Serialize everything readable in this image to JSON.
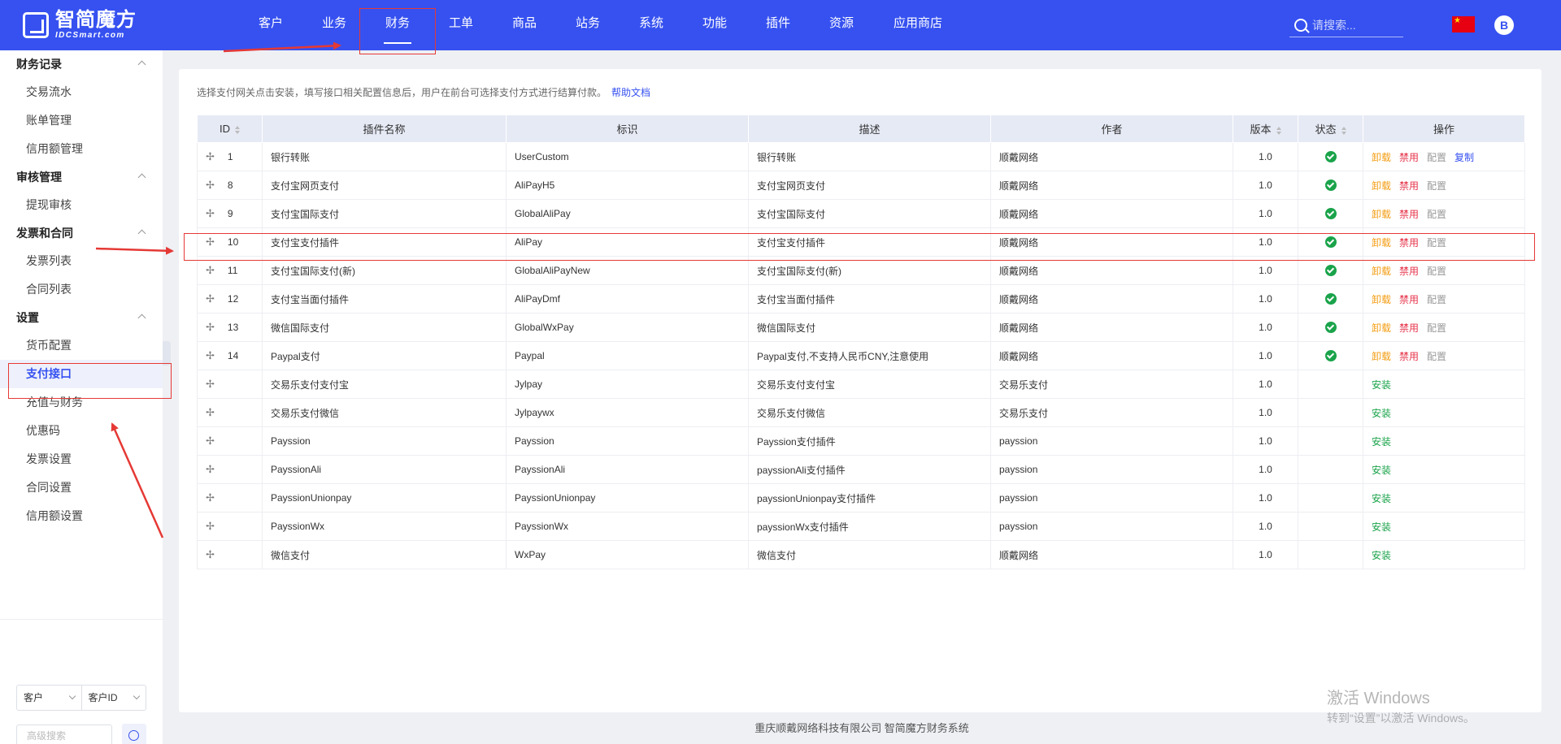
{
  "header": {
    "logo_name": "智简魔方",
    "logo_sub": "IDCSmart.com",
    "nav": [
      "客户",
      "业务",
      "财务",
      "工单",
      "商品",
      "站务",
      "系统",
      "功能",
      "插件",
      "资源",
      "应用商店"
    ],
    "active_nav": "财务",
    "search_placeholder": "请搜索...",
    "avatar_letter": "B"
  },
  "sidebar": {
    "groups": [
      {
        "title": "财务记录",
        "items": [
          "交易流水",
          "账单管理",
          "信用额管理"
        ]
      },
      {
        "title": "审核管理",
        "items": [
          "提现审核"
        ]
      },
      {
        "title": "发票和合同",
        "items": [
          "发票列表",
          "合同列表"
        ]
      },
      {
        "title": "设置",
        "items": [
          "货币配置",
          "支付接口",
          "充值与财务",
          "优惠码",
          "发票设置",
          "合同设置",
          "信用额设置"
        ]
      }
    ],
    "active_item": "支付接口",
    "bottom": {
      "select_1": "客户",
      "select_2": "客户ID",
      "adv_search_placeholder": "高级搜索"
    }
  },
  "main": {
    "intro": "选择支付网关点击安装，填写接口相关配置信息后，用户在前台可选择支付方式进行结算付款。",
    "help_link": "帮助文档",
    "columns": [
      "ID",
      "插件名称",
      "标识",
      "描述",
      "作者",
      "版本",
      "状态",
      "操作"
    ],
    "action_labels": {
      "uninstall": "卸载",
      "disable": "禁用",
      "config": "配置",
      "copy": "复制",
      "install": "安装"
    },
    "rows": [
      {
        "id": "1",
        "name": "银行转账",
        "ident": "UserCustom",
        "desc": "银行转账",
        "author": "顺戴网络",
        "version": "1.0",
        "installed": true,
        "copy": true
      },
      {
        "id": "8",
        "name": "支付宝网页支付",
        "ident": "AliPayH5",
        "desc": "支付宝网页支付",
        "author": "顺戴网络",
        "version": "1.0",
        "installed": true,
        "copy": false
      },
      {
        "id": "9",
        "name": "支付宝国际支付",
        "ident": "GlobalAliPay",
        "desc": "支付宝国际支付",
        "author": "顺戴网络",
        "version": "1.0",
        "installed": true,
        "copy": false
      },
      {
        "id": "10",
        "name": "支付宝支付插件",
        "ident": "AliPay",
        "desc": "支付宝支付插件",
        "author": "顺戴网络",
        "version": "1.0",
        "installed": true,
        "copy": false
      },
      {
        "id": "11",
        "name": "支付宝国际支付(新)",
        "ident": "GlobalAliPayNew",
        "desc": "支付宝国际支付(新)",
        "author": "顺戴网络",
        "version": "1.0",
        "installed": true,
        "copy": false
      },
      {
        "id": "12",
        "name": "支付宝当面付插件",
        "ident": "AliPayDmf",
        "desc": "支付宝当面付插件",
        "author": "顺戴网络",
        "version": "1.0",
        "installed": true,
        "copy": false
      },
      {
        "id": "13",
        "name": "微信国际支付",
        "ident": "GlobalWxPay",
        "desc": "微信国际支付",
        "author": "顺戴网络",
        "version": "1.0",
        "installed": true,
        "copy": false
      },
      {
        "id": "14",
        "name": "Paypal支付",
        "ident": "Paypal",
        "desc": "Paypal支付,不支持人民币CNY,注意使用",
        "author": "顺戴网络",
        "version": "1.0",
        "installed": true,
        "copy": false
      },
      {
        "id": "",
        "name": "交易乐支付支付宝",
        "ident": "Jylpay",
        "desc": "交易乐支付支付宝",
        "author": "交易乐支付",
        "version": "1.0",
        "installed": false,
        "copy": false
      },
      {
        "id": "",
        "name": "交易乐支付微信",
        "ident": "Jylpaywx",
        "desc": "交易乐支付微信",
        "author": "交易乐支付",
        "version": "1.0",
        "installed": false,
        "copy": false
      },
      {
        "id": "",
        "name": "Payssion",
        "ident": "Payssion",
        "desc": "Payssion支付插件",
        "author": "payssion",
        "version": "1.0",
        "installed": false,
        "copy": false
      },
      {
        "id": "",
        "name": "PayssionAli",
        "ident": "PayssionAli",
        "desc": "payssionAli支付插件",
        "author": "payssion",
        "version": "1.0",
        "installed": false,
        "copy": false
      },
      {
        "id": "",
        "name": "PayssionUnionpay",
        "ident": "PayssionUnionpay",
        "desc": "payssionUnionpay支付插件",
        "author": "payssion",
        "version": "1.0",
        "installed": false,
        "copy": false
      },
      {
        "id": "",
        "name": "PayssionWx",
        "ident": "PayssionWx",
        "desc": "payssionWx支付插件",
        "author": "payssion",
        "version": "1.0",
        "installed": false,
        "copy": false
      },
      {
        "id": "",
        "name": "微信支付",
        "ident": "WxPay",
        "desc": "微信支付",
        "author": "顺戴网络",
        "version": "1.0",
        "installed": false,
        "copy": false
      }
    ]
  },
  "footer": "重庆顺戴网络科技有限公司 智简魔方财务系统",
  "watermark": {
    "line1": "激活 Windows",
    "line2": "转到“设置”以激活 Windows。"
  },
  "colors": {
    "brand": "#3651f0",
    "annotation": "#e53935",
    "success": "#1aa34a",
    "warning": "#f39c12",
    "danger": "#e6334a"
  }
}
